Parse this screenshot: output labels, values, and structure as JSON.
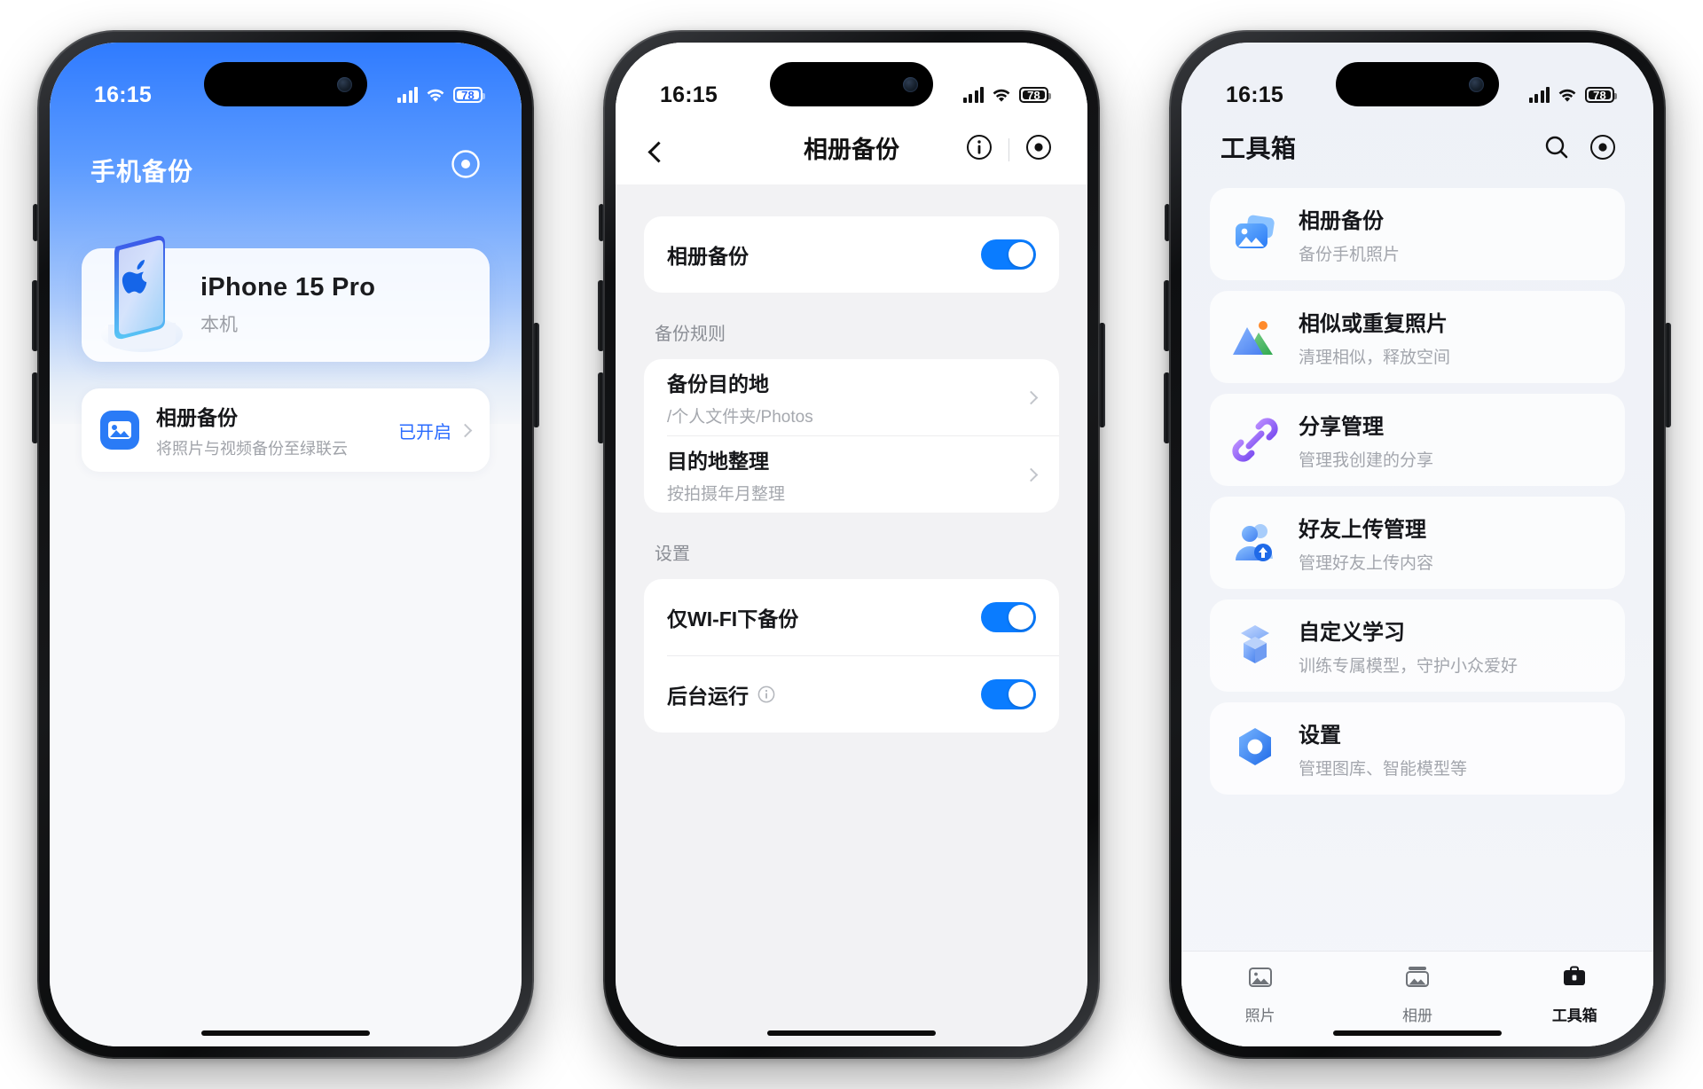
{
  "status_bar": {
    "time": "16:15",
    "battery": "78",
    "signal_icon": "cellular-bars-icon",
    "wifi_icon": "wifi-icon",
    "battery_icon": "battery-icon"
  },
  "phone1": {
    "title": "手机备份",
    "target_icon": "target-icon",
    "device": {
      "name": "iPhone 15 Pro",
      "subtitle": "本机",
      "art_icon": "iphone-device-icon"
    },
    "backup_row": {
      "icon": "photo-backup-icon",
      "title": "相册备份",
      "subtitle": "将照片与视频备份至绿联云",
      "state": "已开启",
      "chevron_icon": "chevron-right-icon"
    }
  },
  "phone2": {
    "nav": {
      "back_icon": "chevron-left-icon",
      "title": "相册备份",
      "info_icon": "info-circle-icon",
      "target_icon": "target-icon"
    },
    "main_toggle": {
      "label": "相册备份",
      "enabled": true
    },
    "section_rules": {
      "label": "备份规则",
      "rows": [
        {
          "title": "备份目的地",
          "subtitle": "/个人文件夹/Photos",
          "chevron_icon": "chevron-right-icon"
        },
        {
          "title": "目的地整理",
          "subtitle": "按拍摄年月整理",
          "chevron_icon": "chevron-right-icon"
        }
      ]
    },
    "section_settings": {
      "label": "设置",
      "rows": [
        {
          "title": "仅WI-FI下备份",
          "enabled": true,
          "has_info": false
        },
        {
          "title": "后台运行",
          "enabled": true,
          "has_info": true,
          "info_icon": "info-circle-icon"
        }
      ]
    }
  },
  "phone3": {
    "title": "工具箱",
    "search_icon": "search-icon",
    "target_icon": "target-icon",
    "tools": [
      {
        "icon": "photo-stack-icon",
        "title": "相册备份",
        "subtitle": "备份手机照片"
      },
      {
        "icon": "mountains-icon",
        "title": "相似或重复照片",
        "subtitle": "清理相似，释放空间"
      },
      {
        "icon": "link-icon",
        "title": "分享管理",
        "subtitle": "管理我创建的分享"
      },
      {
        "icon": "friends-upload-icon",
        "title": "好友上传管理",
        "subtitle": "管理好友上传内容"
      },
      {
        "icon": "cubes-icon",
        "title": "自定义学习",
        "subtitle": "训练专属模型，守护小众爱好"
      },
      {
        "icon": "settings-hex-icon",
        "title": "设置",
        "subtitle": "管理图库、智能模型等"
      }
    ],
    "tabs": [
      {
        "icon": "photos-tab-icon",
        "label": "照片",
        "active": false
      },
      {
        "icon": "albums-tab-icon",
        "label": "相册",
        "active": false
      },
      {
        "icon": "toolbox-tab-icon",
        "label": "工具箱",
        "active": true
      }
    ]
  },
  "colors": {
    "accent": "#2a6bff",
    "toggle_on": "#0a7cff",
    "hero_top": "#2f7bff",
    "hero_bottom": "#e5edf8"
  }
}
